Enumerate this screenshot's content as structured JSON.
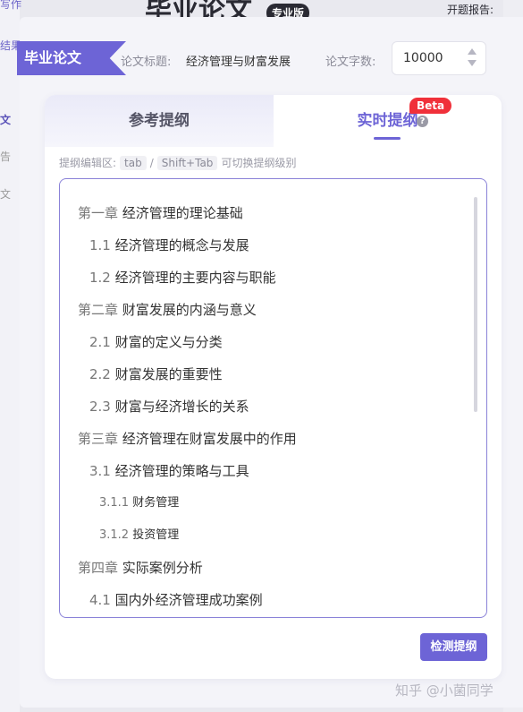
{
  "background": {
    "title": "毕业论文",
    "badge": "专业版",
    "report_label": "开题报告:",
    "side_items": [
      "写作",
      "结果",
      "文",
      "告",
      "文"
    ]
  },
  "modal": {
    "tag": "毕业论文",
    "title_label": "论文标题:",
    "title_value": "经济管理与财富发展",
    "word_count_label": "论文字数:",
    "word_count_value": "10000",
    "tabs": {
      "reference": "参考提纲",
      "live": "实时提纲",
      "beta": "Beta",
      "help": "?"
    },
    "hint": {
      "prefix": "提纲编辑区:",
      "key1": "tab",
      "sep": "/",
      "key2": "Shift+Tab",
      "suffix": "可切换提纲级别"
    },
    "outline": [
      {
        "level": 1,
        "num": "第一章",
        "text": "经济管理的理论基础"
      },
      {
        "level": 2,
        "num": "1.1",
        "text": "经济管理的概念与发展"
      },
      {
        "level": 2,
        "num": "1.2",
        "text": "经济管理的主要内容与职能"
      },
      {
        "level": 1,
        "num": "第二章",
        "text": "财富发展的内涵与意义"
      },
      {
        "level": 2,
        "num": "2.1",
        "text": "财富的定义与分类"
      },
      {
        "level": 2,
        "num": "2.2",
        "text": "财富发展的重要性"
      },
      {
        "level": 2,
        "num": "2.3",
        "text": "财富与经济增长的关系"
      },
      {
        "level": 1,
        "num": "第三章",
        "text": "经济管理在财富发展中的作用"
      },
      {
        "level": 2,
        "num": "3.1",
        "text": "经济管理的策略与工具"
      },
      {
        "level": 3,
        "num": "3.1.1",
        "text": "财务管理"
      },
      {
        "level": 3,
        "num": "3.1.2",
        "text": "投资管理"
      },
      {
        "level": 1,
        "num": "第四章",
        "text": "实际案例分析"
      },
      {
        "level": 2,
        "num": "4.1",
        "text": "国内外经济管理成功案例"
      }
    ],
    "check_button": "检测提纲"
  },
  "watermark": "知乎 @小菌同学",
  "colors": {
    "accent": "#6d64d6",
    "beta": "#f0303a"
  }
}
